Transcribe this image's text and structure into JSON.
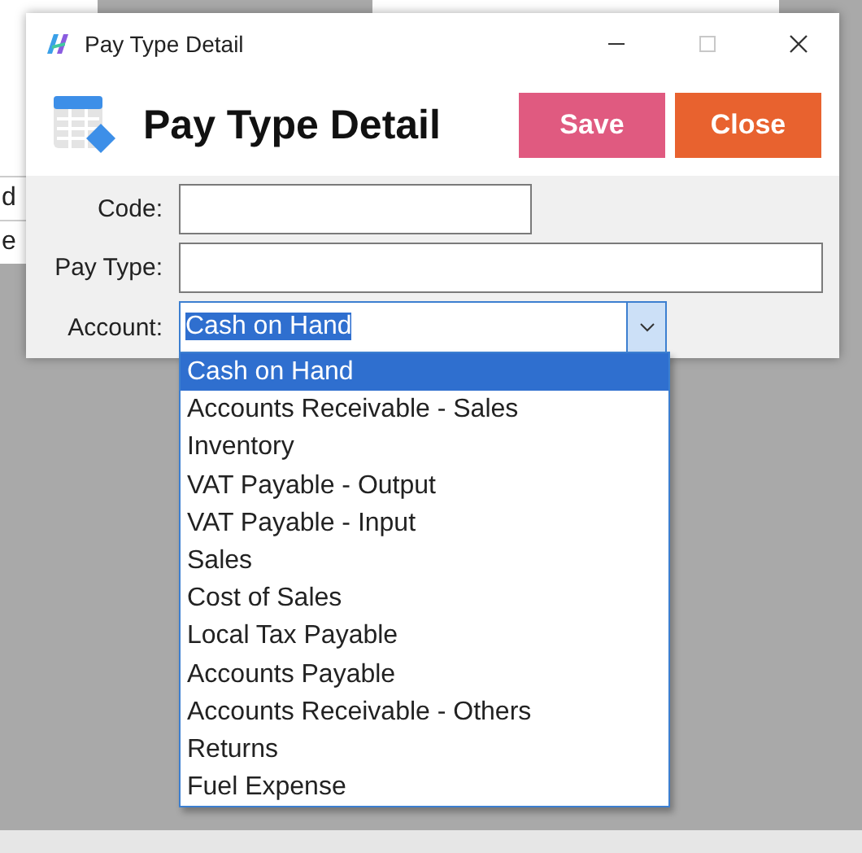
{
  "background": {
    "cells": [
      "d",
      "e"
    ]
  },
  "window": {
    "title": "Pay Type Detail",
    "maximize_disabled": true
  },
  "header": {
    "title": "Pay Type Detail",
    "buttons": [
      {
        "label": "Save",
        "kind": "save"
      },
      {
        "label": "Close",
        "kind": "close"
      }
    ]
  },
  "fields": [
    {
      "label": "Code:",
      "kind": "short"
    },
    {
      "label": "Pay Type:",
      "kind": "wide"
    }
  ],
  "account": {
    "label": "Account:",
    "value": "Cash on Hand",
    "value_highlighted": true,
    "expanded": true,
    "options": [
      {
        "label": "Cash on Hand",
        "selected": true
      },
      {
        "label": "Accounts Receivable - Sales",
        "selected": false
      },
      {
        "label": "Inventory",
        "selected": false
      },
      {
        "label": "VAT Payable - Output",
        "selected": false
      },
      {
        "label": "VAT Payable - Input",
        "selected": false
      },
      {
        "label": "Sales",
        "selected": false
      },
      {
        "label": "Cost of Sales",
        "selected": false
      },
      {
        "label": "Local Tax Payable",
        "selected": false
      },
      {
        "label": "Accounts Payable",
        "selected": false
      },
      {
        "label": "Accounts Receivable - Others",
        "selected": false
      },
      {
        "label": "Returns",
        "selected": false
      },
      {
        "label": "Fuel Expense",
        "selected": false
      }
    ]
  }
}
